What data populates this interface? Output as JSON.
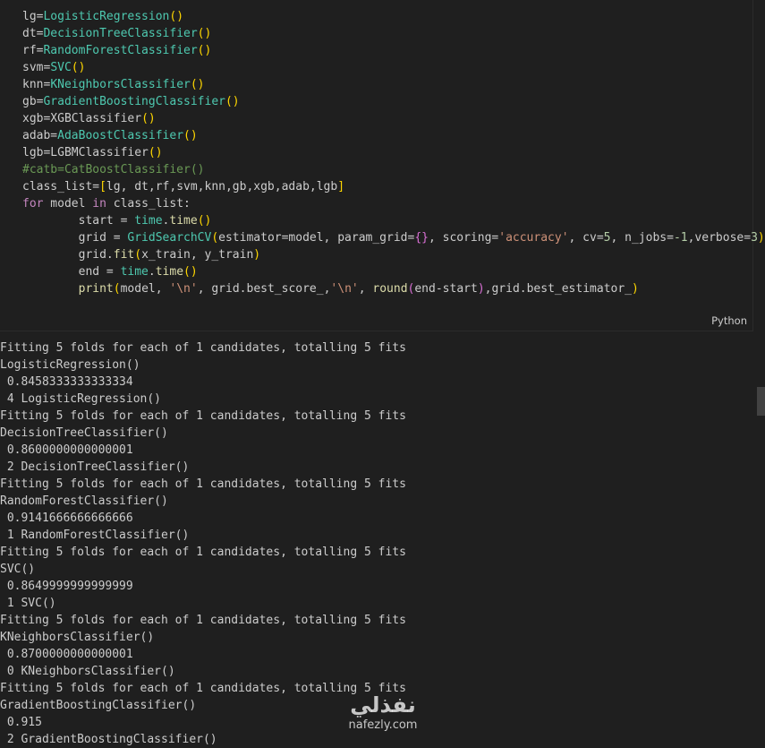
{
  "code_cell": {
    "language_label": "Python",
    "lines": [
      [
        {
          "t": "lg=",
          "c": "c-plain"
        },
        {
          "t": "LogisticRegression",
          "c": "c-type"
        },
        {
          "t": "()",
          "c": "c-brk"
        }
      ],
      [
        {
          "t": "dt=",
          "c": "c-plain"
        },
        {
          "t": "DecisionTreeClassifier",
          "c": "c-type"
        },
        {
          "t": "()",
          "c": "c-brk"
        }
      ],
      [
        {
          "t": "rf=",
          "c": "c-plain"
        },
        {
          "t": "RandomForestClassifier",
          "c": "c-type"
        },
        {
          "t": "()",
          "c": "c-brk"
        }
      ],
      [
        {
          "t": "svm=",
          "c": "c-plain"
        },
        {
          "t": "SVC",
          "c": "c-type"
        },
        {
          "t": "()",
          "c": "c-brk"
        }
      ],
      [
        {
          "t": "knn=",
          "c": "c-plain"
        },
        {
          "t": "KNeighborsClassifier",
          "c": "c-type"
        },
        {
          "t": "()",
          "c": "c-brk"
        }
      ],
      [
        {
          "t": "gb=",
          "c": "c-plain"
        },
        {
          "t": "GradientBoostingClassifier",
          "c": "c-type"
        },
        {
          "t": "()",
          "c": "c-brk"
        }
      ],
      [
        {
          "t": "xgb=XGBClassifier",
          "c": "c-plain"
        },
        {
          "t": "()",
          "c": "c-brk"
        }
      ],
      [
        {
          "t": "adab=",
          "c": "c-plain"
        },
        {
          "t": "AdaBoostClassifier",
          "c": "c-type"
        },
        {
          "t": "()",
          "c": "c-brk"
        }
      ],
      [
        {
          "t": "lgb=LGBMClassifier",
          "c": "c-plain"
        },
        {
          "t": "()",
          "c": "c-brk"
        }
      ],
      [
        {
          "t": "#catb=CatBoostClassifier()",
          "c": "c-com"
        }
      ],
      [
        {
          "t": "class_list=",
          "c": "c-plain"
        },
        {
          "t": "[",
          "c": "c-brk"
        },
        {
          "t": "lg, dt,rf,svm,knn,gb,xgb,adab,lgb",
          "c": "c-plain"
        },
        {
          "t": "]",
          "c": "c-brk"
        }
      ],
      [
        {
          "t": "for",
          "c": "c-kw"
        },
        {
          "t": " model ",
          "c": "c-plain"
        },
        {
          "t": "in",
          "c": "c-kw"
        },
        {
          "t": " class_list:",
          "c": "c-plain"
        }
      ],
      [
        {
          "t": "        start = ",
          "c": "c-plain"
        },
        {
          "t": "time",
          "c": "c-type"
        },
        {
          "t": ".",
          "c": "c-plain"
        },
        {
          "t": "time",
          "c": "c-fn"
        },
        {
          "t": "()",
          "c": "c-brk"
        }
      ],
      [
        {
          "t": "        grid = ",
          "c": "c-plain"
        },
        {
          "t": "GridSearchCV",
          "c": "c-type"
        },
        {
          "t": "(",
          "c": "c-brk"
        },
        {
          "t": "estimator=model, param_grid=",
          "c": "c-plain"
        },
        {
          "t": "{}",
          "c": "c-brk2"
        },
        {
          "t": ", scoring=",
          "c": "c-plain"
        },
        {
          "t": "'accuracy'",
          "c": "c-str"
        },
        {
          "t": ", cv=",
          "c": "c-plain"
        },
        {
          "t": "5",
          "c": "c-num"
        },
        {
          "t": ", n_jobs=",
          "c": "c-plain"
        },
        {
          "t": "-1",
          "c": "c-num"
        },
        {
          "t": ",verbose=",
          "c": "c-plain"
        },
        {
          "t": "3",
          "c": "c-num"
        },
        {
          "t": ")",
          "c": "c-brk"
        }
      ],
      [
        {
          "t": "        grid.",
          "c": "c-plain"
        },
        {
          "t": "fit",
          "c": "c-fn"
        },
        {
          "t": "(",
          "c": "c-brk"
        },
        {
          "t": "x_train, y_train",
          "c": "c-plain"
        },
        {
          "t": ")",
          "c": "c-brk"
        }
      ],
      [
        {
          "t": "        end = ",
          "c": "c-plain"
        },
        {
          "t": "time",
          "c": "c-type"
        },
        {
          "t": ".",
          "c": "c-plain"
        },
        {
          "t": "time",
          "c": "c-fn"
        },
        {
          "t": "()",
          "c": "c-brk"
        }
      ],
      [
        {
          "t": "        ",
          "c": "c-plain"
        },
        {
          "t": "print",
          "c": "c-fn"
        },
        {
          "t": "(",
          "c": "c-brk"
        },
        {
          "t": "model, ",
          "c": "c-plain"
        },
        {
          "t": "'\\n'",
          "c": "c-str"
        },
        {
          "t": ", grid.best_score_,",
          "c": "c-plain"
        },
        {
          "t": "'\\n'",
          "c": "c-str"
        },
        {
          "t": ", ",
          "c": "c-plain"
        },
        {
          "t": "round",
          "c": "c-fn"
        },
        {
          "t": "(",
          "c": "c-brk2"
        },
        {
          "t": "end-start",
          "c": "c-plain"
        },
        {
          "t": ")",
          "c": "c-brk2"
        },
        {
          "t": ",grid.best_estimator_",
          "c": "c-plain"
        },
        {
          "t": ")",
          "c": "c-brk"
        }
      ]
    ]
  },
  "output": {
    "lines": [
      "Fitting 5 folds for each of 1 candidates, totalling 5 fits",
      "LogisticRegression()",
      " 0.8458333333333334",
      " 4 LogisticRegression()",
      "Fitting 5 folds for each of 1 candidates, totalling 5 fits",
      "DecisionTreeClassifier()",
      " 0.8600000000000001",
      " 2 DecisionTreeClassifier()",
      "Fitting 5 folds for each of 1 candidates, totalling 5 fits",
      "RandomForestClassifier()",
      " 0.9141666666666666",
      " 1 RandomForestClassifier()",
      "Fitting 5 folds for each of 1 candidates, totalling 5 fits",
      "SVC()",
      " 0.8649999999999999",
      " 1 SVC()",
      "Fitting 5 folds for each of 1 candidates, totalling 5 fits",
      "KNeighborsClassifier()",
      " 0.8700000000000001",
      " 0 KNeighborsClassifier()",
      "Fitting 5 folds for each of 1 candidates, totalling 5 fits",
      "GradientBoostingClassifier()",
      " 0.915",
      " 2 GradientBoostingClassifier()"
    ]
  },
  "watermark": {
    "mark": "نفذلي",
    "url": "nafezly.com"
  }
}
